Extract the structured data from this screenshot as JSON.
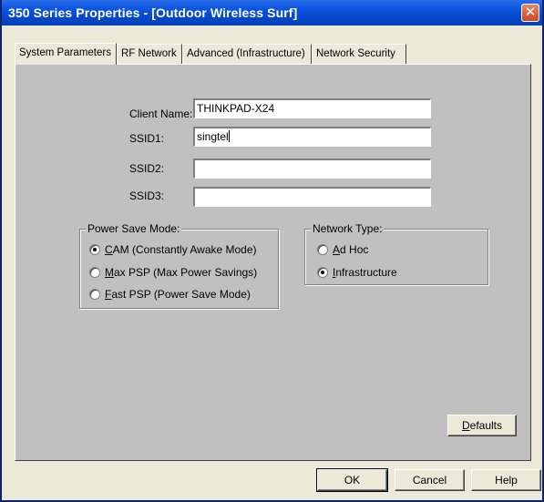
{
  "window": {
    "title": "350 Series Properties - [Outdoor Wireless Surf]",
    "close_glyph": "✕"
  },
  "tabs": [
    {
      "label": "System Parameters",
      "active": true
    },
    {
      "label": "RF Network",
      "active": false
    },
    {
      "label": "Advanced (Infrastructure)",
      "active": false
    },
    {
      "label": "Network Security",
      "active": false
    }
  ],
  "form": {
    "client_name": {
      "label": "Client Name:",
      "value": "THINKPAD-X24"
    },
    "ssid1": {
      "label": "SSID1:",
      "value": "singtel"
    },
    "ssid2": {
      "label": "SSID2:",
      "value": ""
    },
    "ssid3": {
      "label": "SSID3:",
      "value": ""
    }
  },
  "power_save": {
    "title": "Power Save Mode:",
    "options": [
      {
        "mnemonic": "C",
        "rest": "AM (Constantly Awake Mode)",
        "checked": true
      },
      {
        "mnemonic": "M",
        "rest": "ax PSP (Max Power Savings)",
        "checked": false
      },
      {
        "mnemonic": "F",
        "rest": "ast PSP (Power Save Mode)",
        "checked": false
      }
    ]
  },
  "network_type": {
    "title": "Network Type:",
    "options": [
      {
        "mnemonic": "A",
        "rest": "d Hoc",
        "checked": false
      },
      {
        "mnemonic": "I",
        "rest": "nfrastructure",
        "checked": true
      }
    ]
  },
  "buttons": {
    "defaults": {
      "mnemonic": "D",
      "rest": "efaults"
    },
    "ok": "OK",
    "cancel": "Cancel",
    "help": "Help"
  }
}
